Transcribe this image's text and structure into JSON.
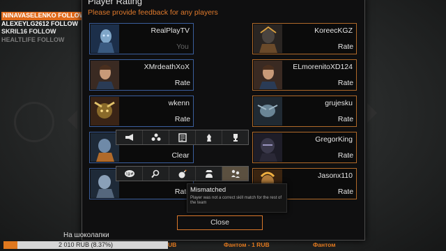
{
  "stream_overlay": {
    "follows": [
      {
        "name": "NINAVASELENKO",
        "action": "FOLLOW"
      },
      {
        "name": "ALEXEYLG2612",
        "action": "FOLLOW"
      },
      {
        "name": "SKRIL16",
        "action": "FOLLOW"
      },
      {
        "name": "HEALTLIFE",
        "action": "FOLLOW"
      }
    ],
    "donation_goal": {
      "label": "На шоколапки",
      "progress_text": "2 010 RUB (8.37%)",
      "percent": 8.37
    },
    "ticker": {
      "item_left": "UB",
      "item_mid": "Фантом - 1 RUB",
      "item_right": "Фантом"
    }
  },
  "dialog": {
    "title": "Player Rating",
    "subtitle": "Please provide feedback for any players",
    "team_left": [
      {
        "name": "RealPlayTV",
        "button": "You"
      },
      {
        "name": "XMrdeathXoX",
        "button": "Rate"
      },
      {
        "name": "wkenn",
        "button": "Rate"
      },
      {
        "name": "",
        "button": "Clear"
      },
      {
        "name": "",
        "button": "Rate"
      }
    ],
    "team_right": [
      {
        "name": "KoreecKGZ",
        "button": "Rate"
      },
      {
        "name": "ELmorenitoXD124",
        "button": "Rate"
      },
      {
        "name": "grujesku",
        "button": "Rate"
      },
      {
        "name": "GregorKing",
        "button": "Rate"
      },
      {
        "name": "Jasonx110",
        "button": "Rate"
      }
    ],
    "positive_icons": [
      "megaphone-icon",
      "team-icon",
      "tactics-icon",
      "chess-icon",
      "trophy-icon"
    ],
    "negative_icons": [
      "rage-icon",
      "search-icon",
      "bomb-icon",
      "anonymous-icon",
      "mismatch-icon"
    ],
    "active_negative_index": 4,
    "tooltip": {
      "title": "Mismatched",
      "description": "Player was not a correct skill match for the rest of the team"
    },
    "close_label": "Close"
  },
  "colors": {
    "accent": "#e0781e",
    "team_blue": "#3b5f9e",
    "team_orange": "#b06a2a"
  }
}
